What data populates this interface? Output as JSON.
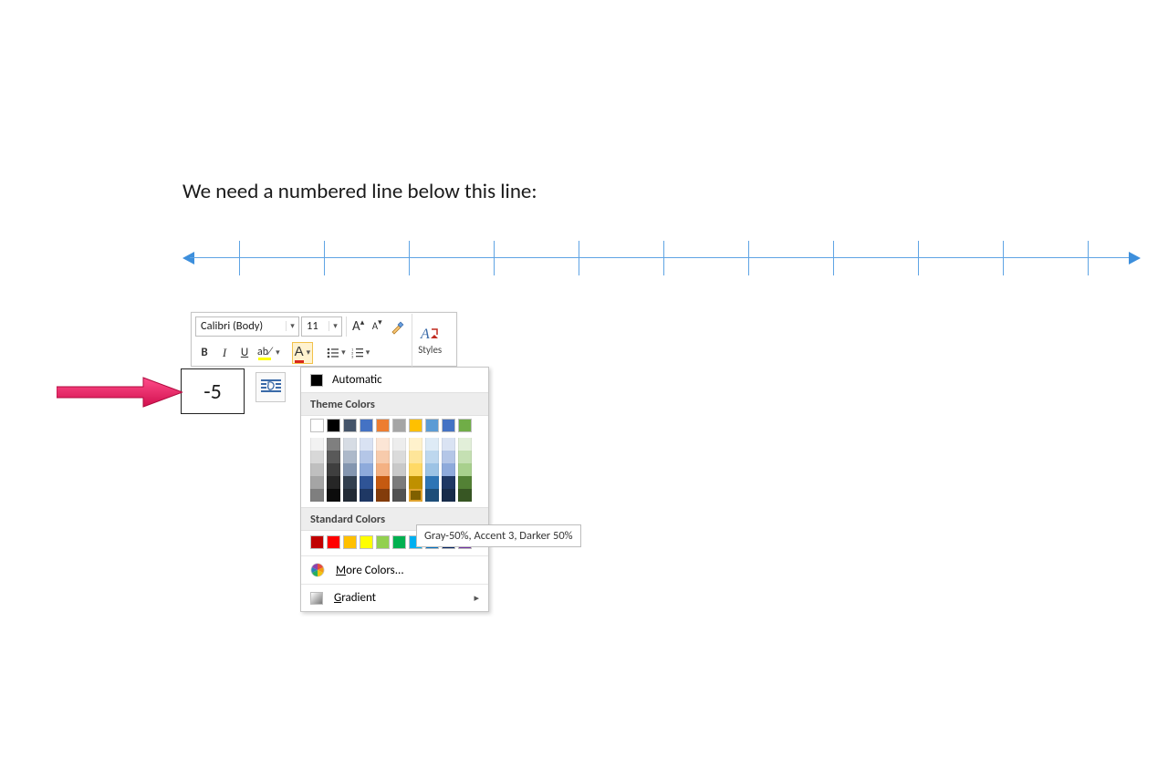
{
  "heading": "We need a numbered line below this line:",
  "textbox_value": "-5",
  "number_line": {
    "ticks": 11,
    "color": "#5fa4e4"
  },
  "mini_toolbar": {
    "font_name": "Calibri (Body)",
    "font_size": "11",
    "grow_font": "A",
    "shrink_font": "A",
    "format_painter": "✎",
    "styles_label": "Styles",
    "bold": "B",
    "italic": "I",
    "underline": "U",
    "strike": "abc",
    "font_color_letter": "A",
    "font_color_current": "#d8261b",
    "highlight_color": "#ffff00",
    "bullets": "≣",
    "numbering": "1≡"
  },
  "color_popup": {
    "automatic_label": "Automatic",
    "automatic_letter": "A",
    "theme_label": "Theme Colors",
    "theme_row": [
      "#ffffff",
      "#000000",
      "#44546a",
      "#4472c4",
      "#ed7d31",
      "#a5a5a5",
      "#ffc000",
      "#5b9bd5",
      "#4472c4",
      "#70ad47"
    ],
    "tints": [
      [
        "#f2f2f2",
        "#7f7f7f",
        "#d6dce4",
        "#d9e2f3",
        "#fbe5d5",
        "#ededed",
        "#fff2cc",
        "#deebf6",
        "#dae3f3",
        "#e2efd9"
      ],
      [
        "#d8d8d8",
        "#595959",
        "#adb9ca",
        "#b4c6e7",
        "#f7cbac",
        "#dbdbdb",
        "#fee599",
        "#bdd7ee",
        "#b4c6e7",
        "#c5e0b3"
      ],
      [
        "#bfbfbf",
        "#3f3f3f",
        "#8496b0",
        "#8eaadb",
        "#f4b183",
        "#c9c9c9",
        "#ffd965",
        "#9cc3e5",
        "#8eaadb",
        "#a8d08d"
      ],
      [
        "#a5a5a5",
        "#262626",
        "#323f4f",
        "#2f5496",
        "#c55a11",
        "#7b7b7b",
        "#bf9000",
        "#2e75b5",
        "#1f3864",
        "#538135"
      ],
      [
        "#7f7f7f",
        "#0c0c0c",
        "#222a35",
        "#1f3864",
        "#833c0b",
        "#525252",
        "#7f6000",
        "#1e4e79",
        "#172b4a",
        "#375623"
      ]
    ],
    "tint_selected": {
      "row": 4,
      "col": 6
    },
    "standard_label": "Standard Colors",
    "standard_row": [
      "#c00000",
      "#ff0000",
      "#ffc000",
      "#ffff00",
      "#92d050",
      "#00b050",
      "#00b0f0",
      "#0070c0",
      "#002060",
      "#7030a0"
    ],
    "more_colors_label": "More Colors...",
    "more_colors_letter": "M",
    "gradient_label": "Gradient",
    "gradient_letter": "G"
  },
  "tooltip": "Gray-50%, Accent 3, Darker 50%"
}
